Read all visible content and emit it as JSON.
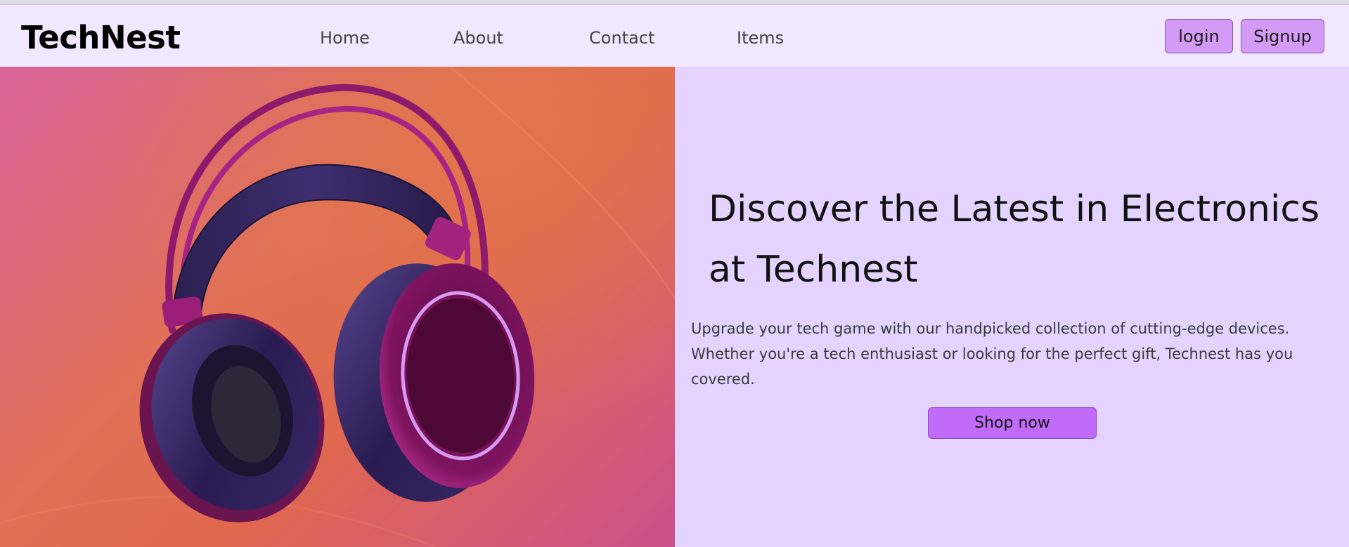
{
  "header": {
    "brand": "TechNest",
    "nav": [
      {
        "label": "Home"
      },
      {
        "label": "About"
      },
      {
        "label": "Contact"
      },
      {
        "label": "Items"
      }
    ],
    "login_label": "login",
    "signup_label": "Signup"
  },
  "hero": {
    "title": "Discover the Latest in Electronics at Technest",
    "description": "Upgrade your tech game with our handpicked collection of cutting-edge devices. Whether you're a tech enthusiast or looking for the perfect gift, Technest has you covered.",
    "cta_label": "Shop now",
    "image_icon": "headphones-icon"
  },
  "colors": {
    "nav_background": "#f1e8ff",
    "hero_text_background": "#e4d3ff",
    "auth_button": "#d39bf5",
    "cta_button": "#c06bfa"
  }
}
